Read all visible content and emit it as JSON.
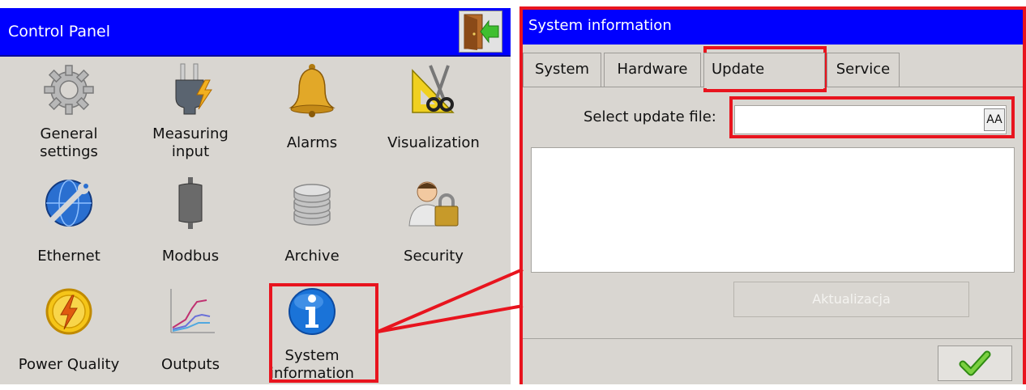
{
  "colors": {
    "titlebar": "#0000ff",
    "panel_background": "#d9d6d1",
    "annotation_red": "#e8141e",
    "ok_check": "#4caf1a"
  },
  "control_panel": {
    "title": "Control Panel",
    "exit_icon": "exit-door-icon",
    "tiles": [
      {
        "label": "General\nsettings",
        "icon": "gear-icon"
      },
      {
        "label": "Measuring\ninput",
        "icon": "plug-bolt-icon"
      },
      {
        "label": "Alarms",
        "icon": "bell-icon"
      },
      {
        "label": "Visualization",
        "icon": "ruler-scissors-icon"
      },
      {
        "label": "Ethernet",
        "icon": "globe-wrench-icon"
      },
      {
        "label": "Modbus",
        "icon": "cylinder-icon"
      },
      {
        "label": "Archive",
        "icon": "database-icon"
      },
      {
        "label": "Security",
        "icon": "user-lock-icon"
      },
      {
        "label": "Power Quality",
        "icon": "power-bolt-icon"
      },
      {
        "label": "Outputs",
        "icon": "line-chart-icon"
      },
      {
        "label": "System\ninformation",
        "icon": "info-icon"
      }
    ]
  },
  "dialog": {
    "title": "System information",
    "tabs": [
      "System",
      "Hardware",
      "Update",
      "Service"
    ],
    "active_tab": "Update",
    "select_update_label": "Select update file:",
    "update_file_value": "",
    "font_button_label": "AA",
    "update_button_label": "Aktualizacja",
    "ok_icon": "checkmark-icon"
  }
}
